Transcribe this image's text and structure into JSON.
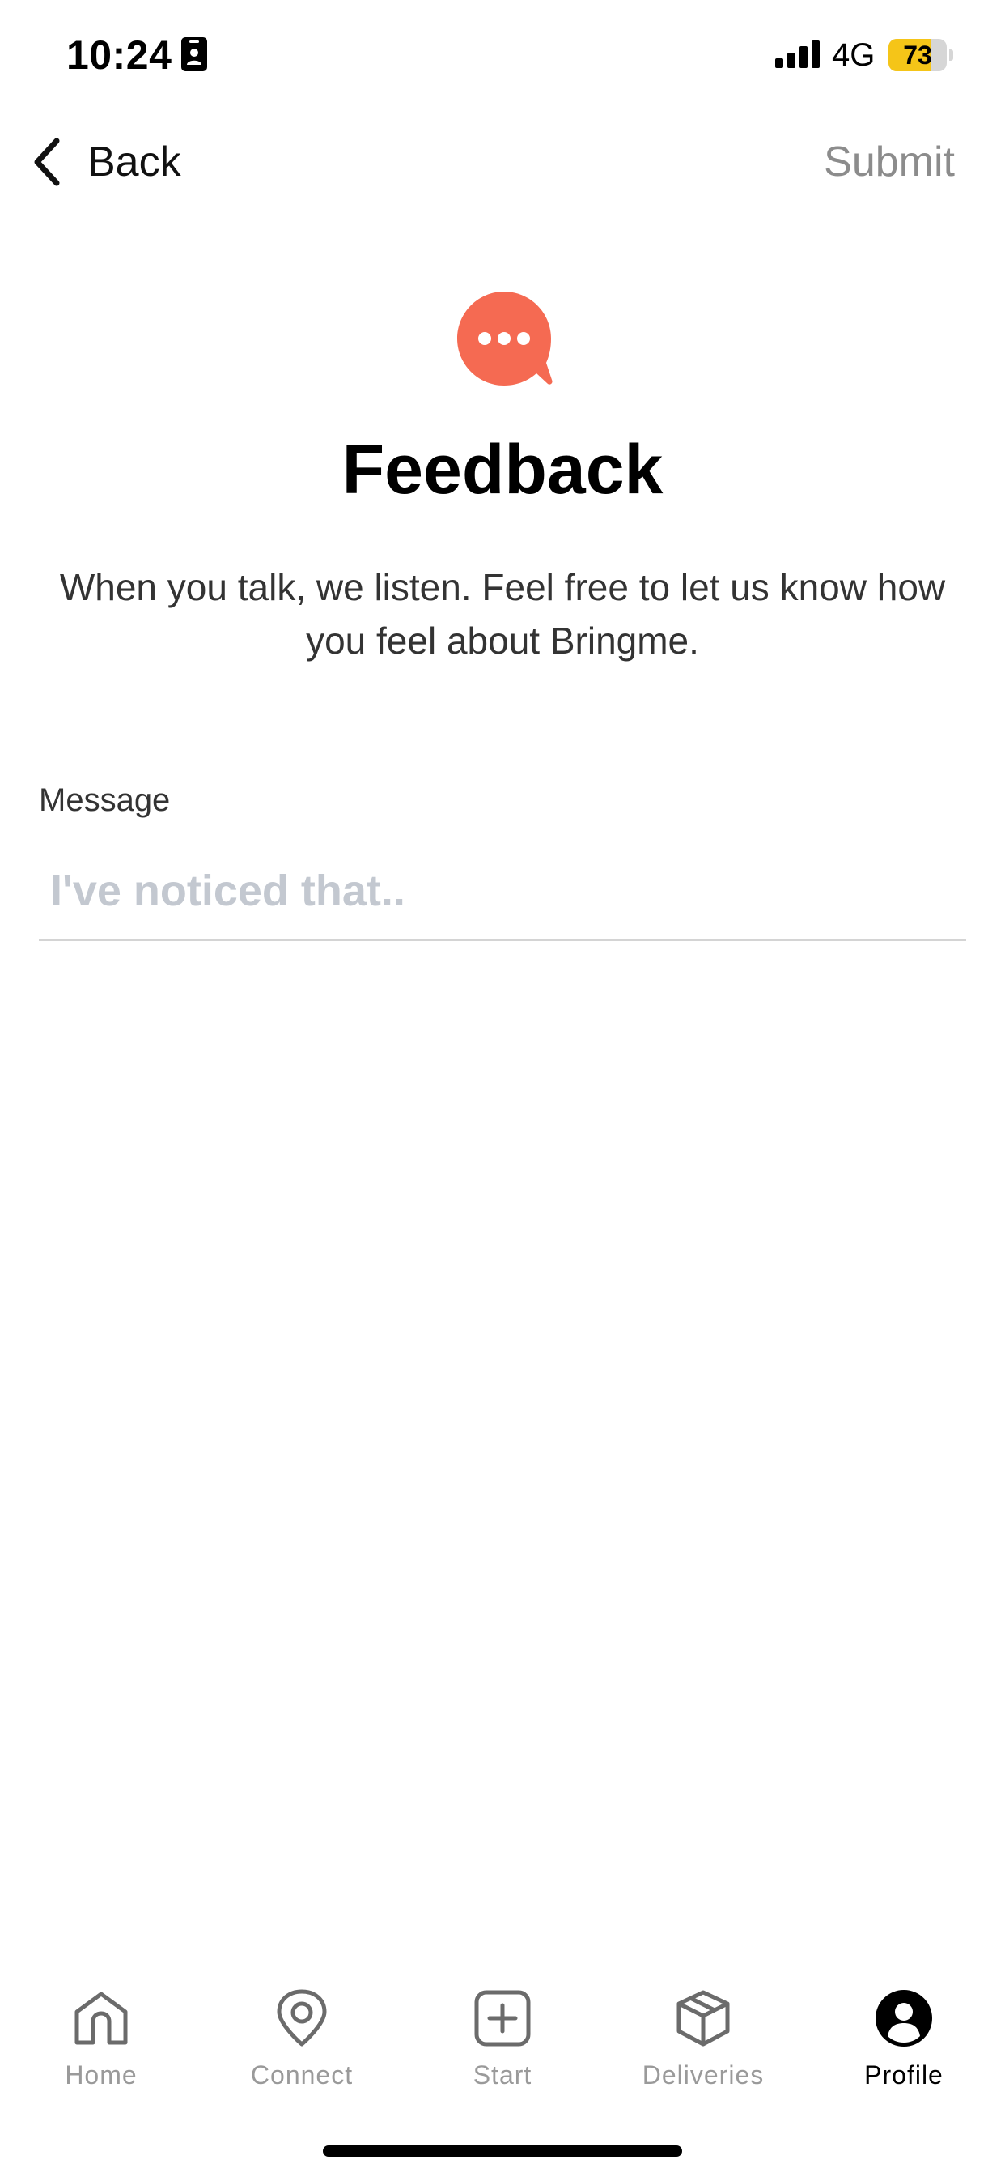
{
  "status_bar": {
    "time": "10:24",
    "network": "4G",
    "battery_level": "73",
    "battery_fraction": 0.73,
    "battery_color": "#f5c518",
    "icons": [
      "contact-card-icon",
      "signal-bars-icon",
      "battery-icon"
    ]
  },
  "nav": {
    "back_label": "Back",
    "submit_label": "Submit"
  },
  "header": {
    "icon": "chat-bubble-icon",
    "icon_color": "#f56a52",
    "title": "Feedback",
    "subtitle": "When you talk, we listen. Feel free to let us know how you feel about Bringme."
  },
  "form": {
    "message_label": "Message",
    "message_value": "",
    "message_placeholder": "I've noticed that.."
  },
  "tab_bar": {
    "tabs": [
      {
        "label": "Home",
        "icon": "home-icon",
        "active": false
      },
      {
        "label": "Connect",
        "icon": "location-pin-icon",
        "active": false
      },
      {
        "label": "Start",
        "icon": "plus-square-icon",
        "active": false
      },
      {
        "label": "Deliveries",
        "icon": "package-icon",
        "active": false
      },
      {
        "label": "Profile",
        "icon": "user-circle-icon",
        "active": true
      }
    ]
  }
}
